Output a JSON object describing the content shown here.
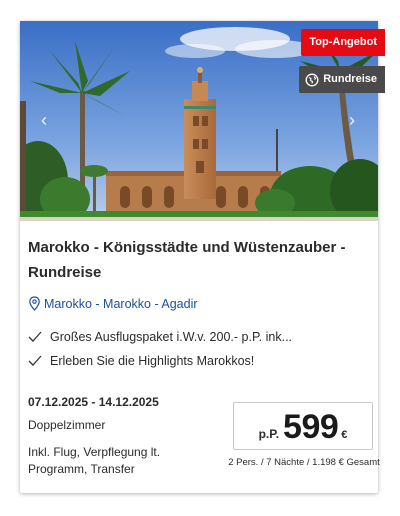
{
  "offer": {
    "badge_top": "Top-Angebot",
    "badge_type": "Rundreise",
    "badge_type_icon": "globe-icon",
    "title": "Marokko - Königsstädte und Wüstenzauber - Rundreise",
    "location": "Marokko - Marokko - Agadir",
    "features": [
      "Großes Ausflugspaket i.W.v. 200.- p.P. ink...",
      "Erleben Sie die Highlights Marokkos!"
    ],
    "dates": "07.12.2025 - 14.12.2025",
    "room": "Doppelzimmer",
    "inclusions": "Inkl. Flug, Verpflegung lt. Programm, Transfer",
    "price": {
      "prefix": "p.P.",
      "value": "599",
      "currency": "€",
      "detail": "2 Pers. / 7 Nächte / 1.198 € Gesamt"
    }
  },
  "colors": {
    "badge_top": "#e60a14",
    "badge_type": "#4a4a4a",
    "location_link": "#1e4f9c"
  }
}
